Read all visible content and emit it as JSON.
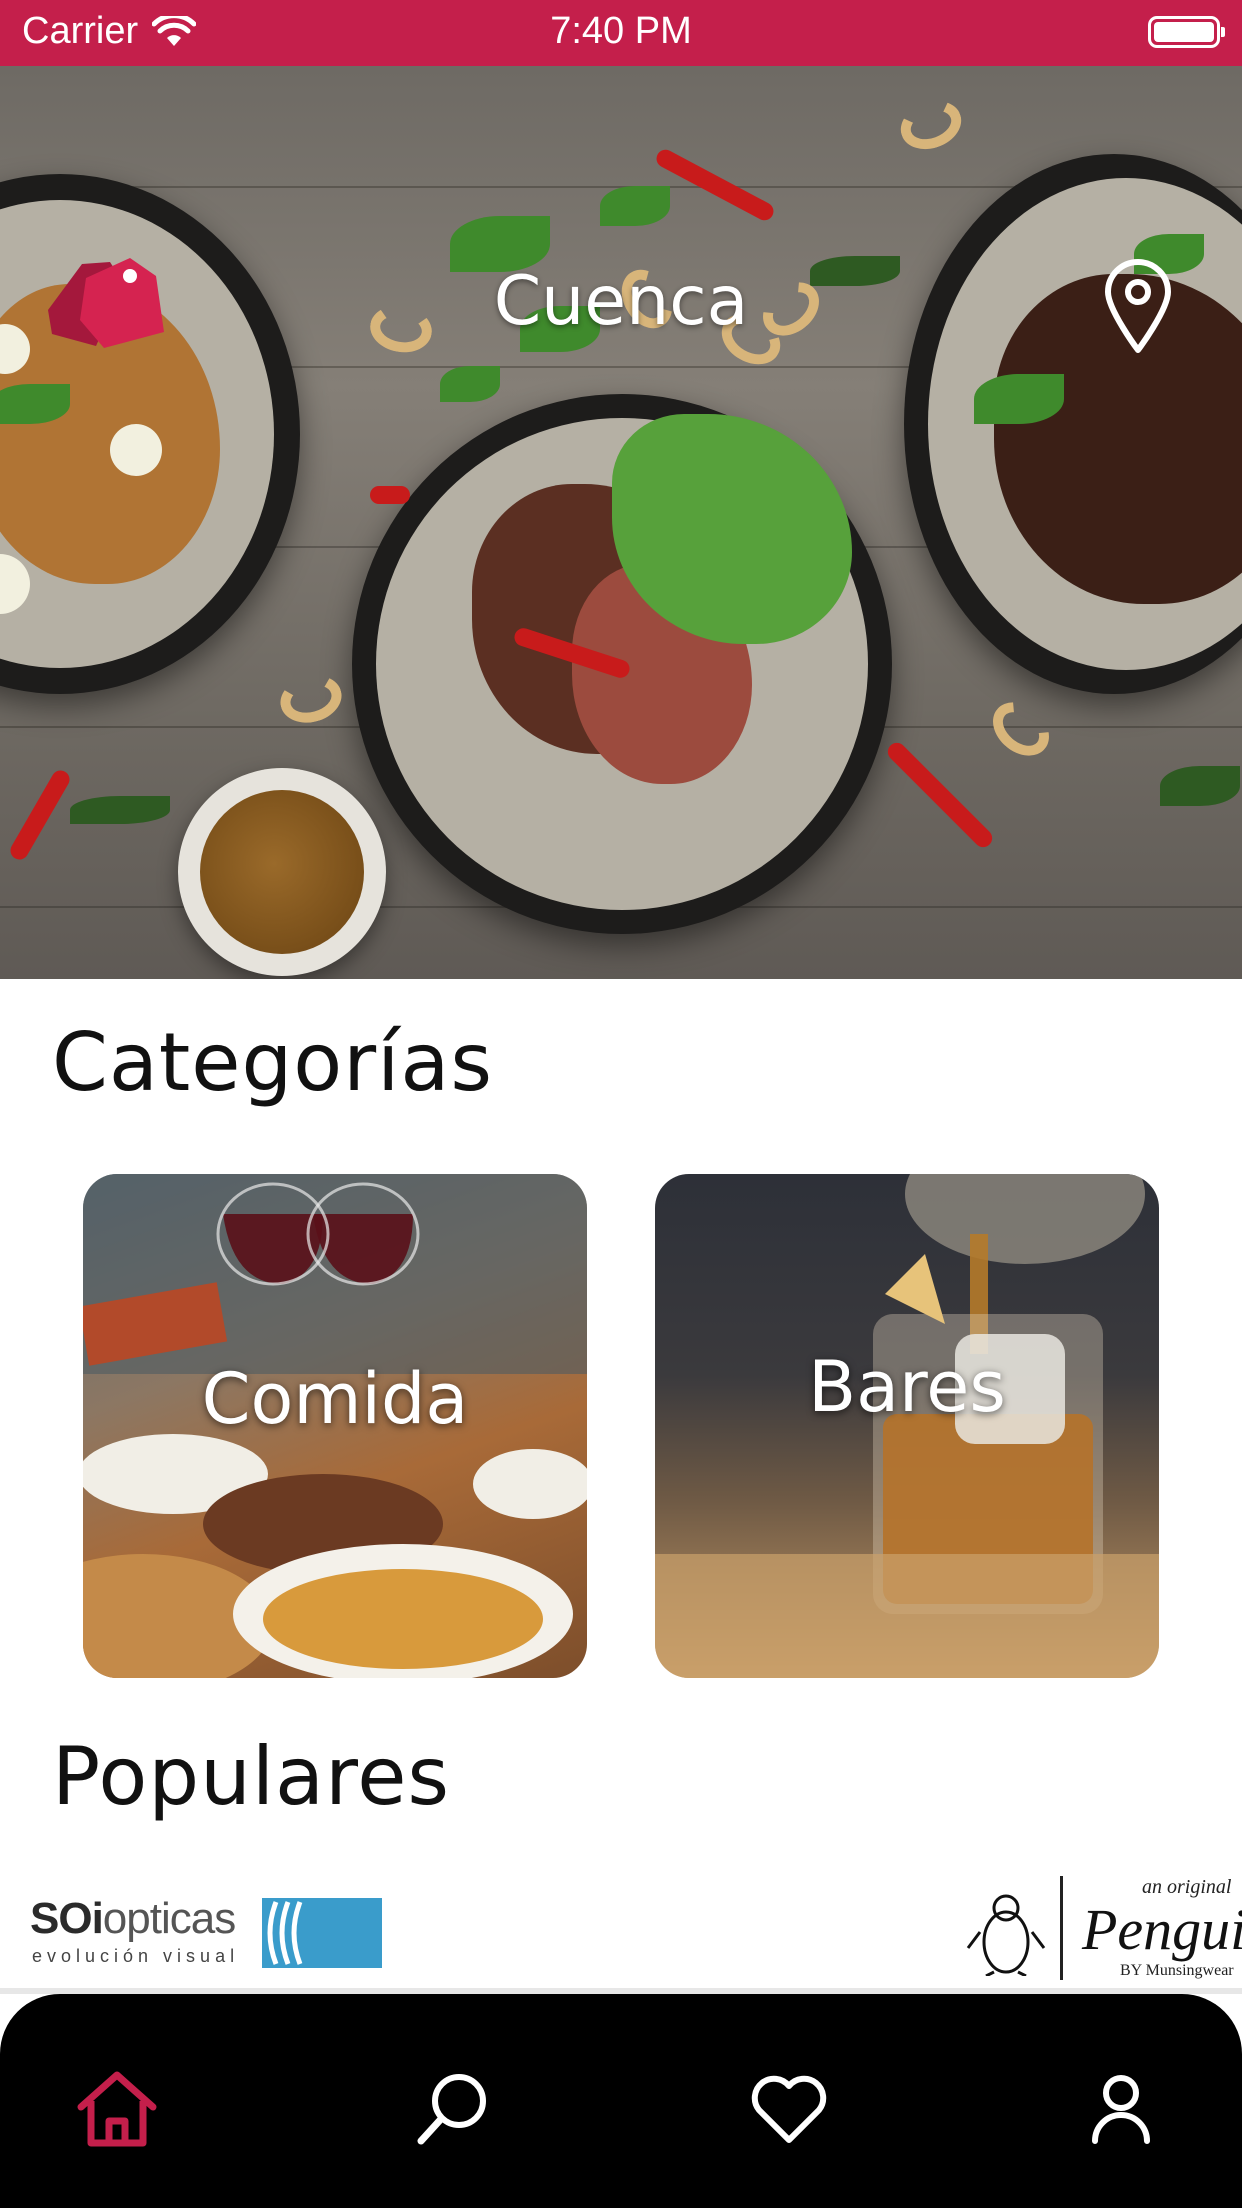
{
  "status_bar": {
    "carrier": "Carrier",
    "time": "7:40 PM"
  },
  "hero": {
    "city": "Cuenca",
    "logo_icon": "price-tag-icon",
    "location_icon": "location-pin-icon"
  },
  "categories": {
    "title": "Categorías",
    "items": [
      {
        "label": "Comida"
      },
      {
        "label": "Bares"
      }
    ]
  },
  "popular": {
    "title": "Populares",
    "brands": [
      {
        "name_bold": "SOi",
        "name_light": "opticas",
        "tagline": "evolución visual"
      },
      {
        "tagline": "an original",
        "name": "Penguin",
        "maker": "BY Munsingwear"
      }
    ]
  },
  "tab_bar": {
    "items": [
      {
        "icon": "home-icon",
        "active": true
      },
      {
        "icon": "search-icon",
        "active": false
      },
      {
        "icon": "heart-icon",
        "active": false
      },
      {
        "icon": "user-icon",
        "active": false
      }
    ]
  },
  "colors": {
    "brand": "#c41f4b",
    "tab_active": "#c41f4b",
    "tab_inactive": "#ffffff",
    "tab_background": "#000000"
  }
}
